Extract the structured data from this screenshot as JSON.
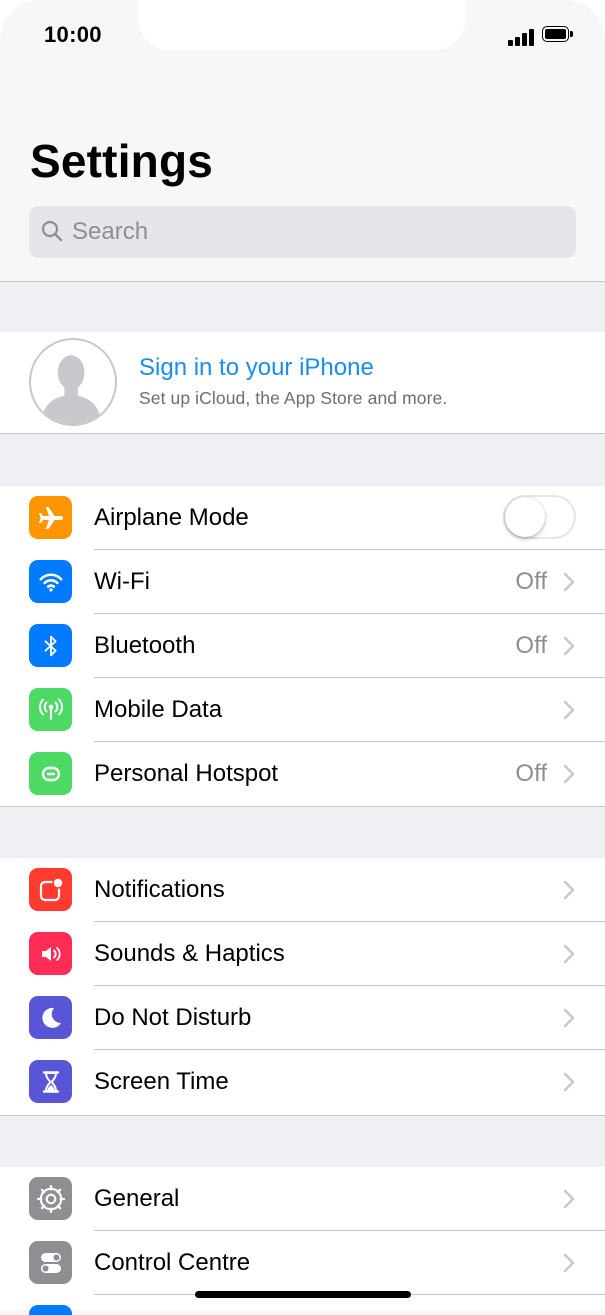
{
  "status": {
    "time": "10:00"
  },
  "header": {
    "title": "Settings"
  },
  "search": {
    "placeholder": "Search"
  },
  "profile": {
    "title": "Sign in to your iPhone",
    "subtitle": "Set up iCloud, the App Store and more."
  },
  "group1": [
    {
      "label": "Airplane Mode",
      "icon": "airplane-icon",
      "color": "#ff9500",
      "control": "toggle",
      "toggle_on": false
    },
    {
      "label": "Wi-Fi",
      "value": "Off",
      "icon": "wifi-icon",
      "color": "#007aff"
    },
    {
      "label": "Bluetooth",
      "value": "Off",
      "icon": "bluetooth-icon",
      "color": "#007aff"
    },
    {
      "label": "Mobile Data",
      "value": "",
      "icon": "antenna-icon",
      "color": "#4cd964"
    },
    {
      "label": "Personal Hotspot",
      "value": "Off",
      "icon": "hotspot-icon",
      "color": "#4cd964"
    }
  ],
  "group2": [
    {
      "label": "Notifications",
      "icon": "notifications-icon",
      "color": "#ff3b30"
    },
    {
      "label": "Sounds & Haptics",
      "icon": "speaker-icon",
      "color": "#ff2d55"
    },
    {
      "label": "Do Not Disturb",
      "icon": "moon-icon",
      "color": "#5856d6"
    },
    {
      "label": "Screen Time",
      "icon": "hourglass-icon",
      "color": "#5856d6"
    }
  ],
  "group3": [
    {
      "label": "General",
      "icon": "gear-icon",
      "color": "#8e8e93"
    },
    {
      "label": "Control Centre",
      "icon": "switches-icon",
      "color": "#8e8e93"
    }
  ]
}
